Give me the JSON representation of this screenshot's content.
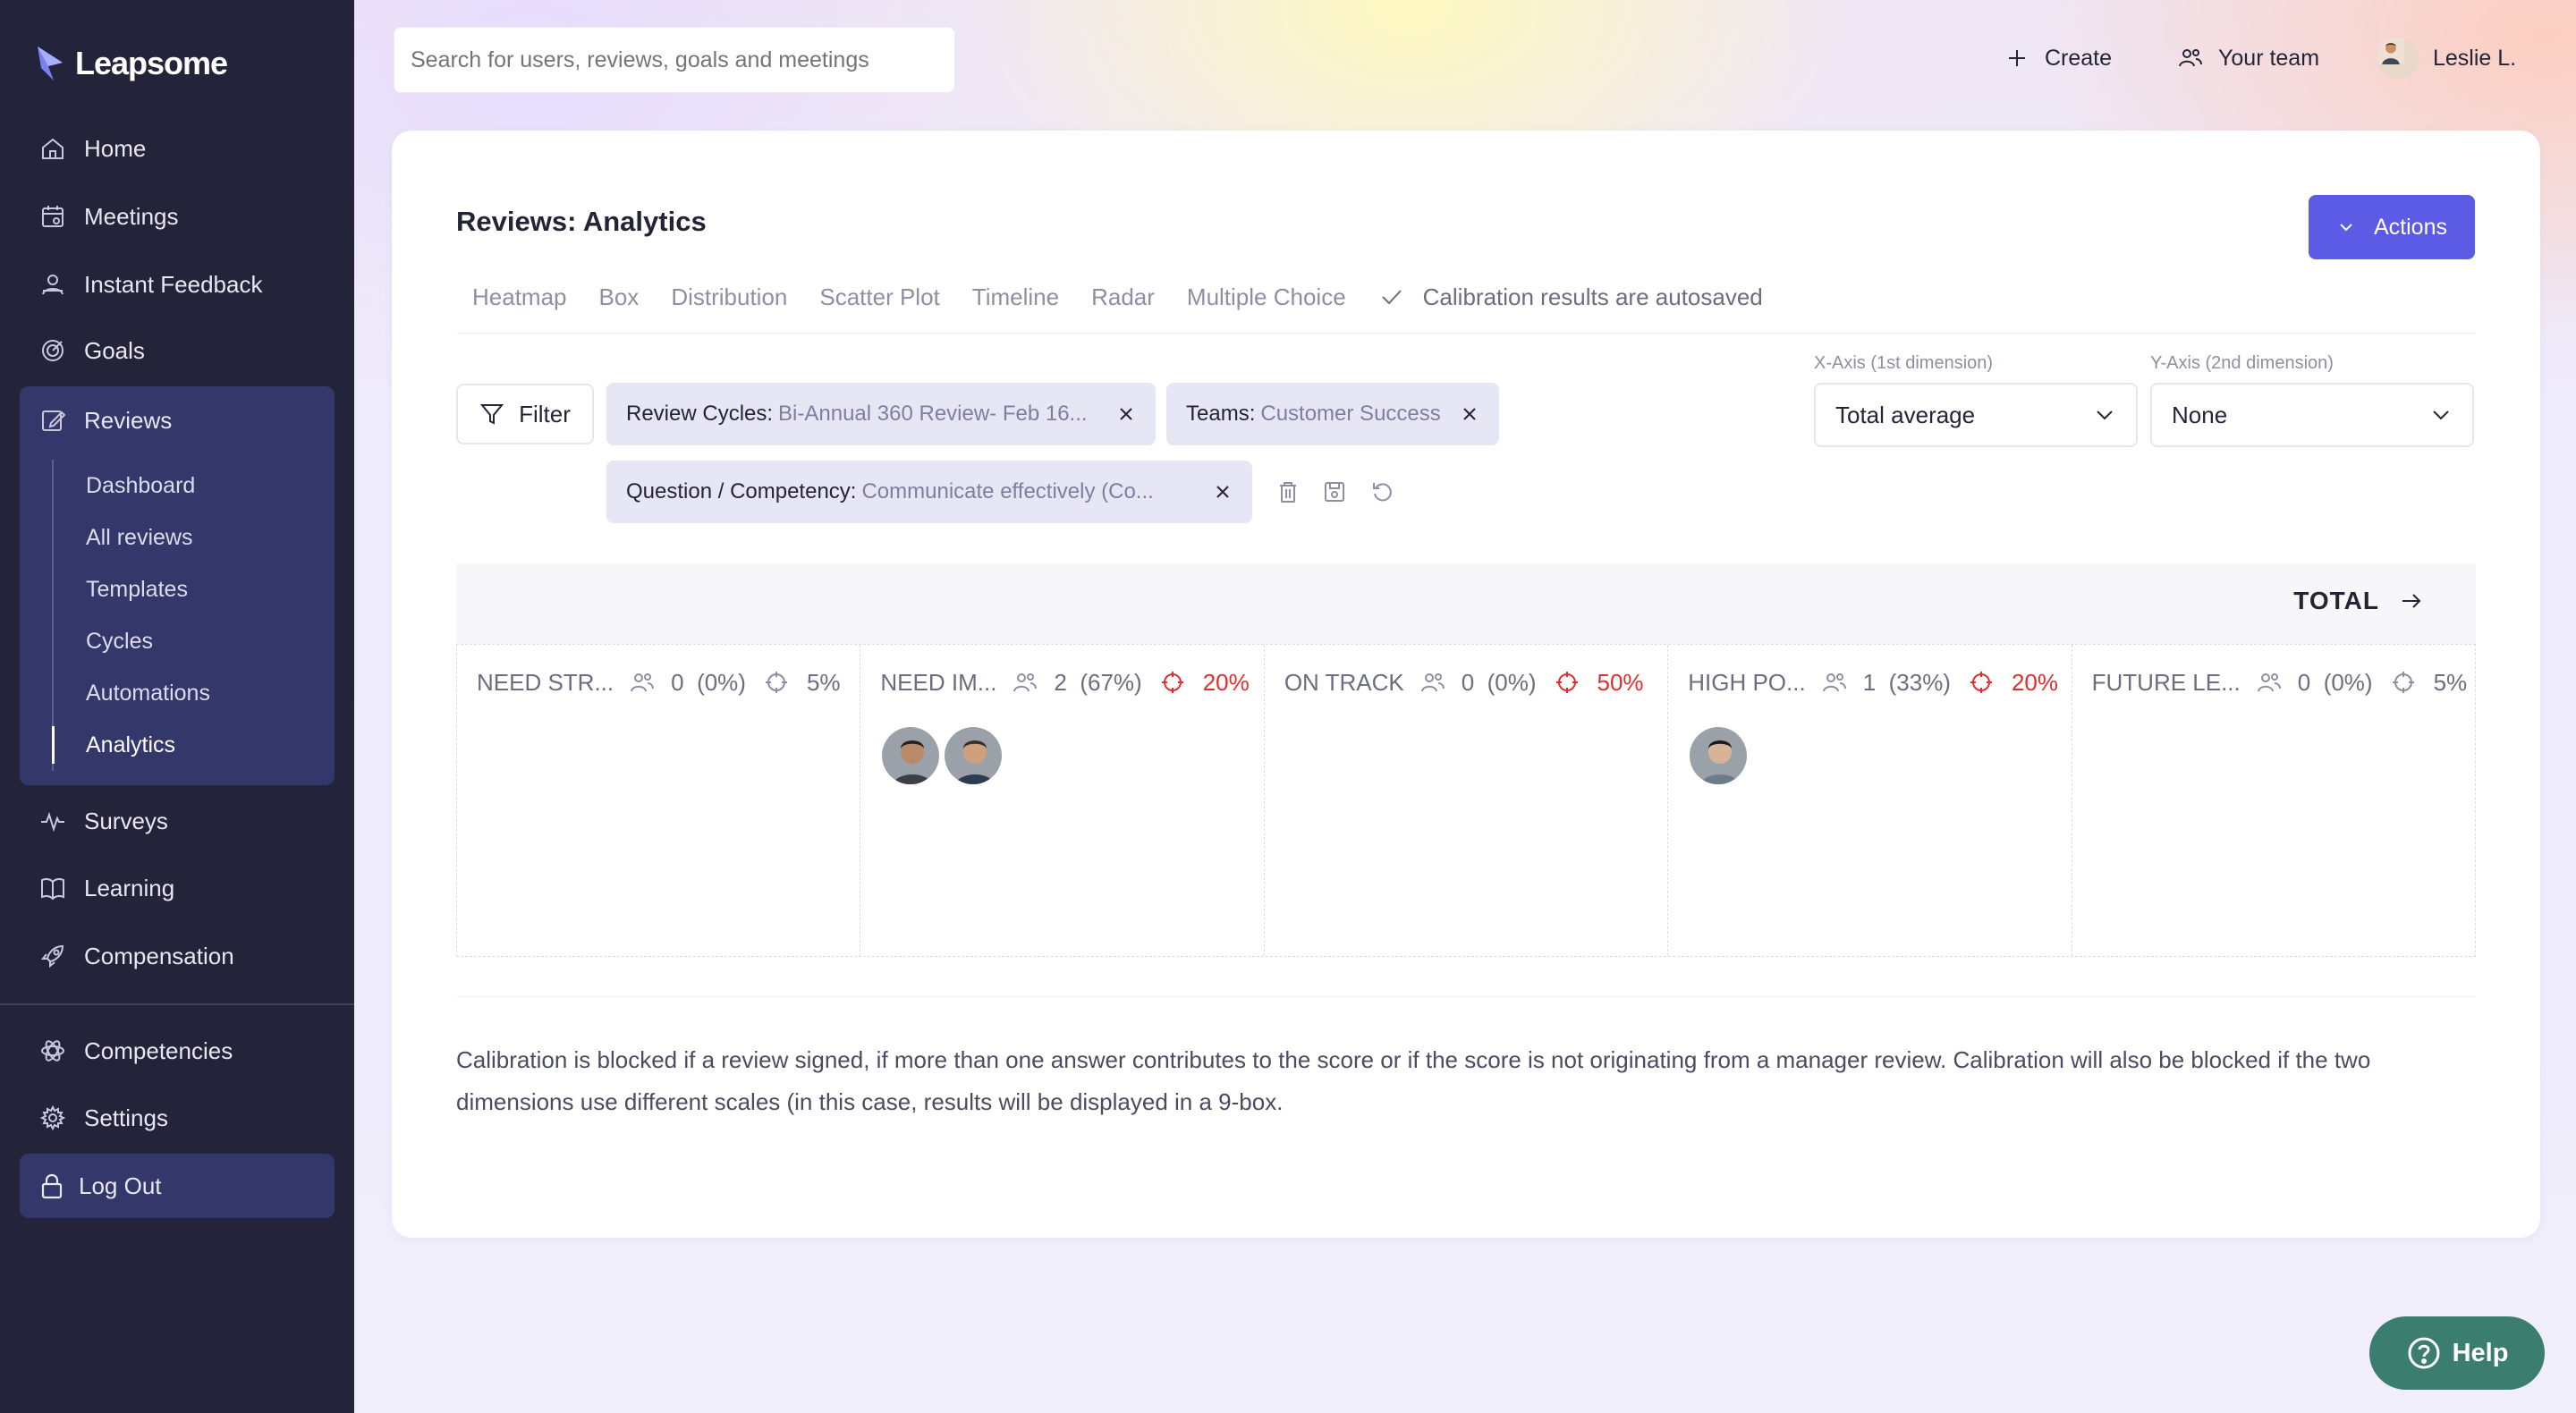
{
  "app": {
    "name": "Leapsome"
  },
  "sidebar": {
    "items": [
      {
        "label": "Home",
        "icon": "home-icon"
      },
      {
        "label": "Meetings",
        "icon": "calendar-icon"
      },
      {
        "label": "Instant Feedback",
        "icon": "feedback-icon"
      },
      {
        "label": "Goals",
        "icon": "target-icon"
      }
    ],
    "reviews": {
      "label": "Reviews",
      "sub": [
        "Dashboard",
        "All reviews",
        "Templates",
        "Cycles",
        "Automations",
        "Analytics"
      ],
      "active": "Analytics"
    },
    "items2": [
      {
        "label": "Surveys",
        "icon": "pulse-icon"
      },
      {
        "label": "Learning",
        "icon": "book-icon"
      },
      {
        "label": "Compensation",
        "icon": "rocket-icon"
      }
    ],
    "items3": [
      {
        "label": "Competencies",
        "icon": "atom-icon"
      },
      {
        "label": "Settings",
        "icon": "gear-icon"
      }
    ],
    "logout": "Log Out"
  },
  "topbar": {
    "search_placeholder": "Search for users, reviews, goals and meetings",
    "create": "Create",
    "team": "Your team",
    "user": "Leslie L."
  },
  "page": {
    "title": "Reviews: Analytics",
    "actions": "Actions",
    "tabs": [
      "Heatmap",
      "Box",
      "Distribution",
      "Scatter Plot",
      "Timeline",
      "Radar",
      "Multiple Choice"
    ],
    "autosave": "Calibration results are autosaved",
    "filter": "Filter",
    "chips": [
      {
        "key": "Review Cycles:",
        "value": "Bi-Annual 360 Review- Feb 16..."
      },
      {
        "key": "Teams:",
        "value": "Customer Success"
      },
      {
        "key": "Question / Competency:",
        "value": "Communicate effectively (Co..."
      }
    ],
    "x_axis": {
      "label": "X-Axis (1st dimension)",
      "value": "Total average"
    },
    "y_axis": {
      "label": "Y-Axis (2nd dimension)",
      "value": "None"
    },
    "total": "TOTAL",
    "columns": [
      {
        "name": "NEED STR...",
        "count": "0",
        "percent": "(0%)",
        "target": "5%",
        "red": false,
        "avatars": 0
      },
      {
        "name": "NEED IM...",
        "count": "2",
        "percent": "(67%)",
        "target": "20%",
        "red": true,
        "avatars": 2
      },
      {
        "name": "ON TRACK",
        "count": "0",
        "percent": "(0%)",
        "target": "50%",
        "red": true,
        "avatars": 0
      },
      {
        "name": "HIGH PO...",
        "count": "1",
        "percent": "(33%)",
        "target": "20%",
        "red": true,
        "avatars": 1
      },
      {
        "name": "FUTURE LE...",
        "count": "0",
        "percent": "(0%)",
        "target": "5%",
        "red": false,
        "avatars": 0
      }
    ],
    "note": "Calibration is blocked if a review signed, if more than one answer contributes to the score or if the score is not originating from a manager review. Calibration will also be blocked if the two dimensions use different scales (in this case, results will be displayed in a 9-box."
  },
  "help": "Help",
  "colors": {
    "accent": "#5b5be6",
    "sidebar": "#232439",
    "danger": "#e02e2e",
    "help": "#3b7d6e"
  }
}
